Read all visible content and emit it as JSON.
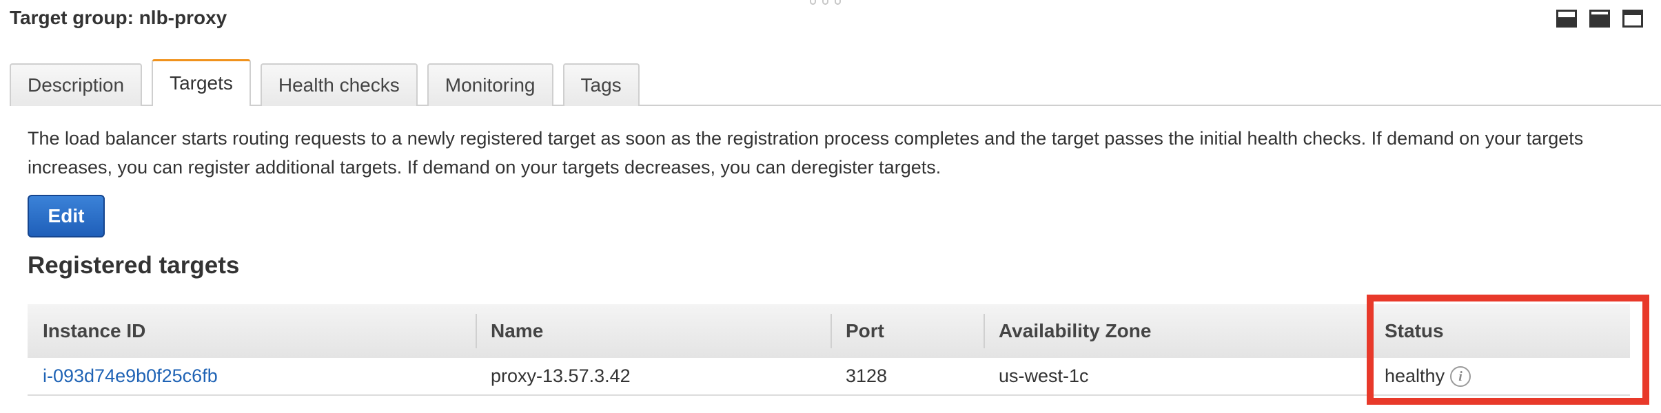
{
  "header": {
    "title": "Target group: nlb-proxy"
  },
  "tabs": [
    {
      "label": "Description"
    },
    {
      "label": "Targets"
    },
    {
      "label": "Health checks"
    },
    {
      "label": "Monitoring"
    },
    {
      "label": "Tags"
    }
  ],
  "active_tab": "Targets",
  "description": "The load balancer starts routing requests to a newly registered target as soon as the registration process completes and the target passes the initial health checks. If demand on your targets increases, you can register additional targets. If demand on your targets decreases, you can deregister targets.",
  "edit_label": "Edit",
  "section_title": "Registered targets",
  "table": {
    "columns": [
      "Instance ID",
      "Name",
      "Port",
      "Availability Zone",
      "Status"
    ],
    "rows": [
      {
        "instance_id": "i-093d74e9b0f25c6fb",
        "name": "proxy-13.57.3.42",
        "port": "3128",
        "zone": "us-west-1c",
        "status": "healthy"
      }
    ]
  },
  "icons": {
    "info": "info-icon",
    "layout": [
      "layout-bottom-icon",
      "layout-split-icon",
      "layout-full-icon"
    ]
  },
  "colors": {
    "highlight": "#e8392a",
    "active_tab_accent": "#f0921c",
    "button": "#1f5fb9",
    "link": "#1f63b5"
  }
}
